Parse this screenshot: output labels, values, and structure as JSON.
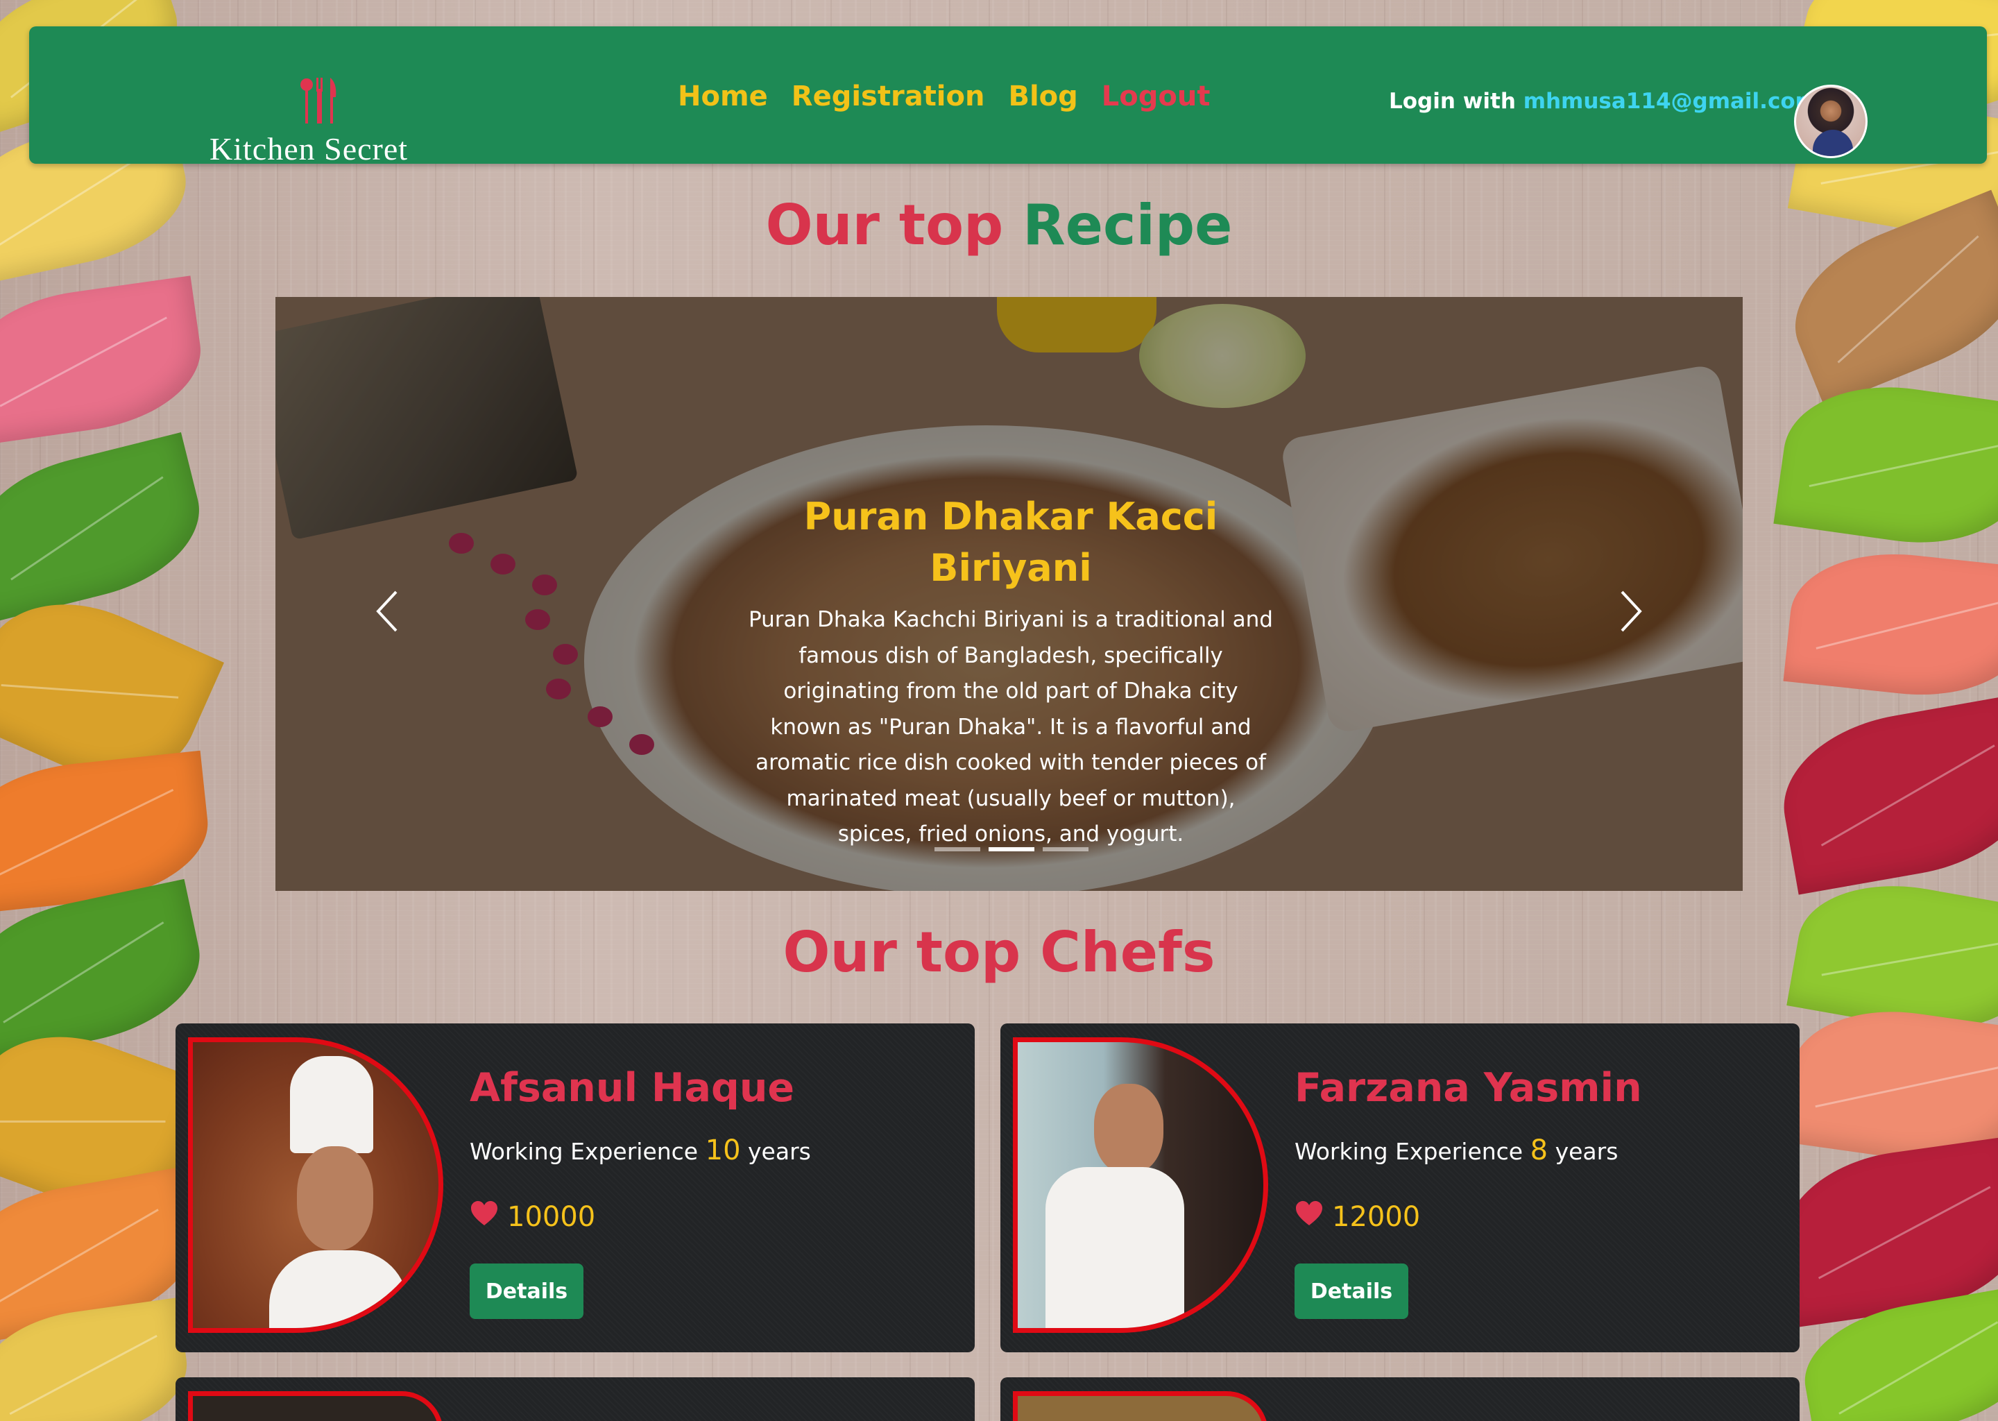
{
  "navbar": {
    "brand_name": "Kitchen Secret",
    "links": [
      "Home",
      "Registration",
      "Blog",
      "Logout"
    ],
    "login_prefix": "Login with",
    "login_email": "mhmusa114@gmail.com"
  },
  "recipes_section": {
    "title_part1": "Our top",
    "title_part2": "Recipe"
  },
  "carousel": {
    "active_index": 1,
    "slide_count": 3,
    "caption_title": "Puran Dhakar Kacci Biriyani",
    "caption_text": "Puran Dhaka Kachchi Biriyani is a traditional and famous dish of Bangladesh, specifically originating from the old part of Dhaka city known as \"Puran Dhaka\". It is a flavorful and aromatic rice dish cooked with tender pieces of marinated meat (usually beef or mutton), spices, fried onions, and yogurt."
  },
  "chefs_section": {
    "title": "Our top Chefs"
  },
  "chefs": [
    {
      "name": "Afsanul Haque",
      "experience_prefix": "Working Experience",
      "experience_years": "10",
      "experience_suffix": "years",
      "likes": "10000",
      "button_label": "Details"
    },
    {
      "name": "Farzana Yasmin",
      "experience_prefix": "Working Experience",
      "experience_years": "8",
      "experience_suffix": "years",
      "likes": "12000",
      "button_label": "Details"
    }
  ],
  "colors": {
    "navbar_green": "#1e8a55",
    "nav_link_yellow": "#f2c218",
    "logout_red": "#e53a4e",
    "heading_red": "#d8344c",
    "email_cyan": "#3ed4f0",
    "photo_border_red": "#e00a14"
  },
  "icons": {
    "brand": "fork-spoon-knife-icon",
    "carousel_prev": "chevron-left-icon",
    "carousel_next": "chevron-right-icon",
    "like": "heart-icon"
  }
}
